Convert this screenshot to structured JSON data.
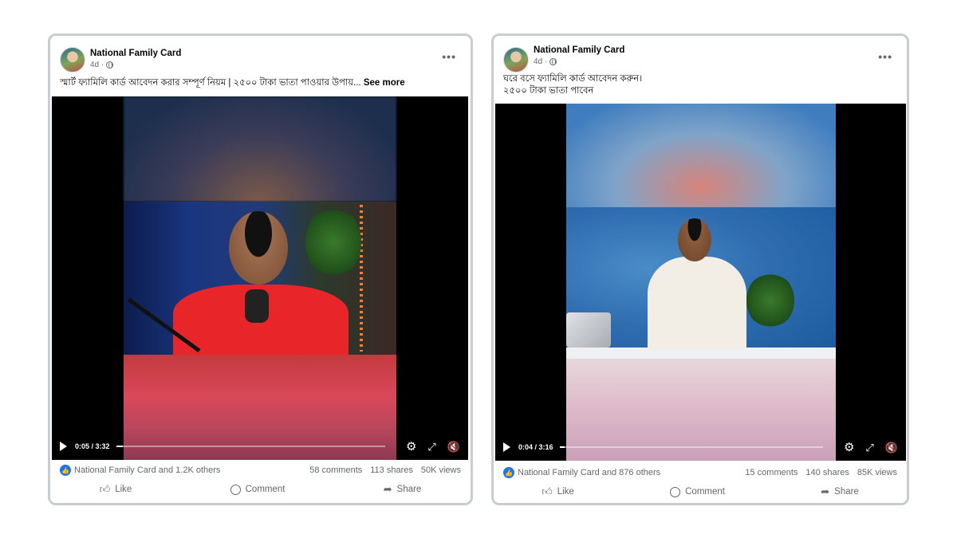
{
  "posts": [
    {
      "page_name": "National Family Card",
      "time_ago": "4d ·",
      "caption_lines": [
        "স্মার্ট ফ্যামিলি কার্ড আবেদন করার সম্পূর্ণ নিয়ম | ২৫০০ টাকা ভাতা পাওয়ার উপায়..."
      ],
      "see_more": "See more",
      "video": {
        "time": "0:05 / 3:32",
        "progress_fraction": 0.025
      },
      "reactors": "National Family Card and 1.2K others",
      "comments": "58 comments",
      "shares": "113 shares",
      "views": "50K views",
      "actions": {
        "like": "Like",
        "comment": "Comment",
        "share": "Share"
      }
    },
    {
      "page_name": "National Family Card",
      "time_ago": "4d ·",
      "caption_lines": [
        "ঘরে বসে ফ্যামিলি কার্ড আবেদন করুন।",
        "২৫০০ টাকা ভাতা পাবেন"
      ],
      "see_more": "",
      "video": {
        "time": "0:04 / 3:16",
        "progress_fraction": 0.02
      },
      "reactors": "National Family Card and 876 others",
      "comments": "15 comments",
      "shares": "140 shares",
      "views": "85K views",
      "actions": {
        "like": "Like",
        "comment": "Comment",
        "share": "Share"
      }
    }
  ],
  "icons": {
    "more": "more-options-icon",
    "globe": "globe-icon",
    "play": "play-icon",
    "settings": "gear-icon",
    "fullscreen": "expand-icon",
    "volume": "mute-icon",
    "like_badge": "like-badge-icon",
    "like": "thumbs-up-icon",
    "comment": "comment-icon",
    "share": "share-icon"
  },
  "colors": {
    "accent": "#1877f2",
    "muted_text": "#65676b",
    "card_border": "#c9ccd1"
  }
}
